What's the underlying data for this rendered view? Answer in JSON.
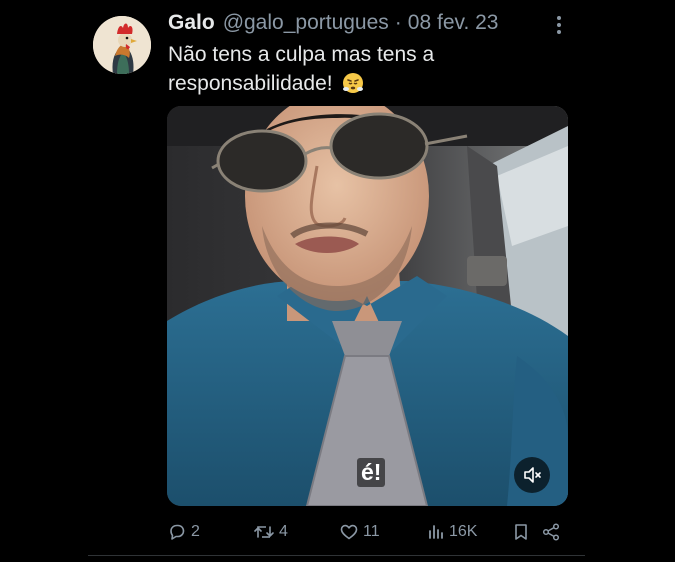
{
  "tweet": {
    "author_name": "Galo",
    "handle": "@galo_portugues",
    "separator": "·",
    "date": "08 fev. 23",
    "text": "Não tens a culpa mas tens a responsabilidade!",
    "emoji": "face-with-steam-icon"
  },
  "media": {
    "caption": "é!",
    "mute_icon": "muted-speaker-icon"
  },
  "actions": {
    "replies": "2",
    "retweets": "4",
    "likes": "11",
    "views": "16K"
  },
  "colors": {
    "background": "#000000",
    "text": "#e7e9ea",
    "muted": "#8b98a5",
    "divider": "#2f3336"
  }
}
